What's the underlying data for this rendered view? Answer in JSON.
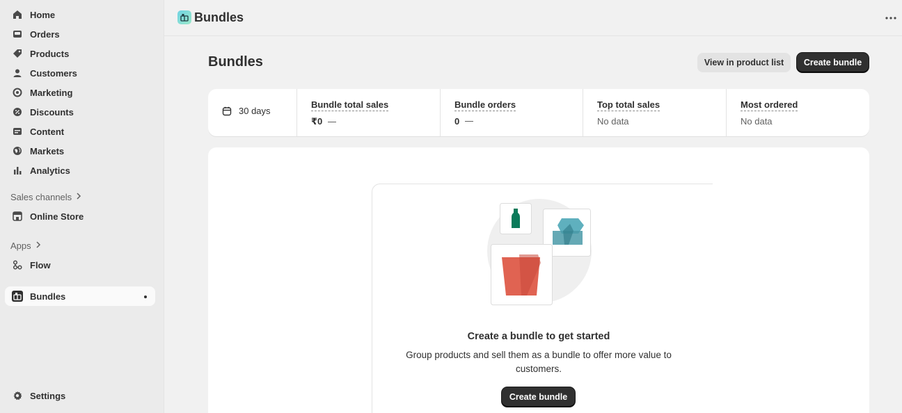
{
  "sidebar": {
    "items": [
      {
        "label": "Home",
        "icon": "home-icon"
      },
      {
        "label": "Orders",
        "icon": "orders-icon"
      },
      {
        "label": "Products",
        "icon": "tag-icon"
      },
      {
        "label": "Customers",
        "icon": "person-icon"
      },
      {
        "label": "Marketing",
        "icon": "target-icon"
      },
      {
        "label": "Discounts",
        "icon": "discount-icon"
      },
      {
        "label": "Content",
        "icon": "content-icon"
      },
      {
        "label": "Markets",
        "icon": "globe-icon"
      },
      {
        "label": "Analytics",
        "icon": "bar-chart-icon"
      }
    ],
    "sales_channels_label": "Sales channels",
    "online_store_label": "Online Store",
    "apps_label": "Apps",
    "flow_label": "Flow",
    "bundles_label": "Bundles",
    "settings_label": "Settings"
  },
  "topbar": {
    "title": "Bundles"
  },
  "page": {
    "title": "Bundles",
    "view_button": "View in product list",
    "create_button": "Create bundle"
  },
  "metrics": {
    "date_range": "30 days",
    "cells": [
      {
        "title": "Bundle total sales",
        "value": "₹0"
      },
      {
        "title": "Bundle orders",
        "value": "0"
      },
      {
        "title": "Top total sales",
        "value": "No data"
      },
      {
        "title": "Most ordered",
        "value": "No data"
      }
    ]
  },
  "empty_state": {
    "heading": "Create a bundle to get started",
    "description": "Group products and sell them as a bundle to offer more value to customers.",
    "button": "Create bundle"
  },
  "colors": {
    "primary_button": "#303030",
    "illustration_red": "#e06352",
    "illustration_teal": "#5fb0be",
    "illustration_green": "#0b7a5a"
  }
}
